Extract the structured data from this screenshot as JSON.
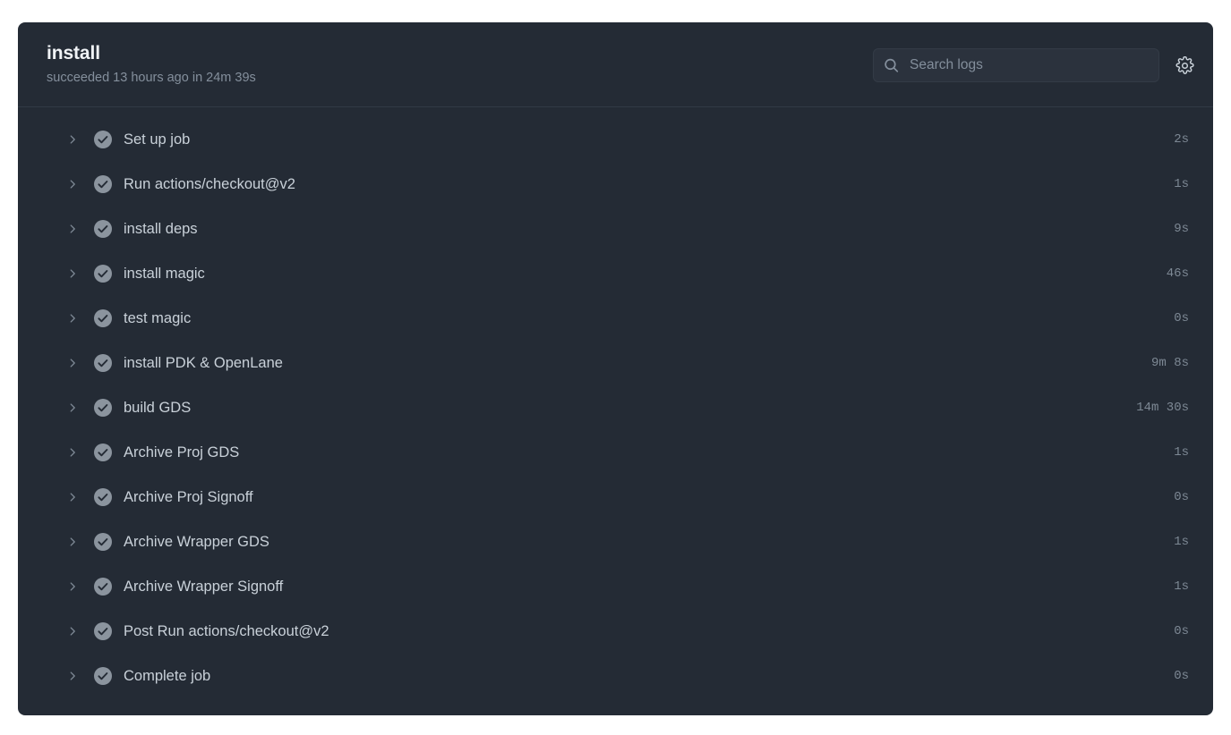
{
  "header": {
    "title": "install",
    "status_line": "succeeded 13 hours ago in 24m 39s",
    "search": {
      "placeholder": "Search logs",
      "value": "",
      "icon": "search-icon"
    },
    "settings_icon": "gear-icon"
  },
  "colors": {
    "panel_bg": "#242b35",
    "page_bg": "#ffffff",
    "border": "#323a45",
    "title": "#f0f3f6",
    "muted": "#848f9c",
    "step_text": "#c9d1d9",
    "success_icon": "#8b949e",
    "duration_text": "#7d8894",
    "search_bg": "#2b323d"
  },
  "steps": [
    {
      "name": "Set up job",
      "duration": "2s",
      "status": "success",
      "expand_icon": "chevron-right-icon",
      "status_icon": "check-circle-icon"
    },
    {
      "name": "Run actions/checkout@v2",
      "duration": "1s",
      "status": "success",
      "expand_icon": "chevron-right-icon",
      "status_icon": "check-circle-icon"
    },
    {
      "name": "install deps",
      "duration": "9s",
      "status": "success",
      "expand_icon": "chevron-right-icon",
      "status_icon": "check-circle-icon"
    },
    {
      "name": "install magic",
      "duration": "46s",
      "status": "success",
      "expand_icon": "chevron-right-icon",
      "status_icon": "check-circle-icon"
    },
    {
      "name": "test magic",
      "duration": "0s",
      "status": "success",
      "expand_icon": "chevron-right-icon",
      "status_icon": "check-circle-icon"
    },
    {
      "name": "install PDK & OpenLane",
      "duration": "9m 8s",
      "status": "success",
      "expand_icon": "chevron-right-icon",
      "status_icon": "check-circle-icon"
    },
    {
      "name": "build GDS",
      "duration": "14m 30s",
      "status": "success",
      "expand_icon": "chevron-right-icon",
      "status_icon": "check-circle-icon"
    },
    {
      "name": "Archive Proj GDS",
      "duration": "1s",
      "status": "success",
      "expand_icon": "chevron-right-icon",
      "status_icon": "check-circle-icon"
    },
    {
      "name": "Archive Proj Signoff",
      "duration": "0s",
      "status": "success",
      "expand_icon": "chevron-right-icon",
      "status_icon": "check-circle-icon"
    },
    {
      "name": "Archive Wrapper GDS",
      "duration": "1s",
      "status": "success",
      "expand_icon": "chevron-right-icon",
      "status_icon": "check-circle-icon"
    },
    {
      "name": "Archive Wrapper Signoff",
      "duration": "1s",
      "status": "success",
      "expand_icon": "chevron-right-icon",
      "status_icon": "check-circle-icon"
    },
    {
      "name": "Post Run actions/checkout@v2",
      "duration": "0s",
      "status": "success",
      "expand_icon": "chevron-right-icon",
      "status_icon": "check-circle-icon"
    },
    {
      "name": "Complete job",
      "duration": "0s",
      "status": "success",
      "expand_icon": "chevron-right-icon",
      "status_icon": "check-circle-icon"
    }
  ]
}
